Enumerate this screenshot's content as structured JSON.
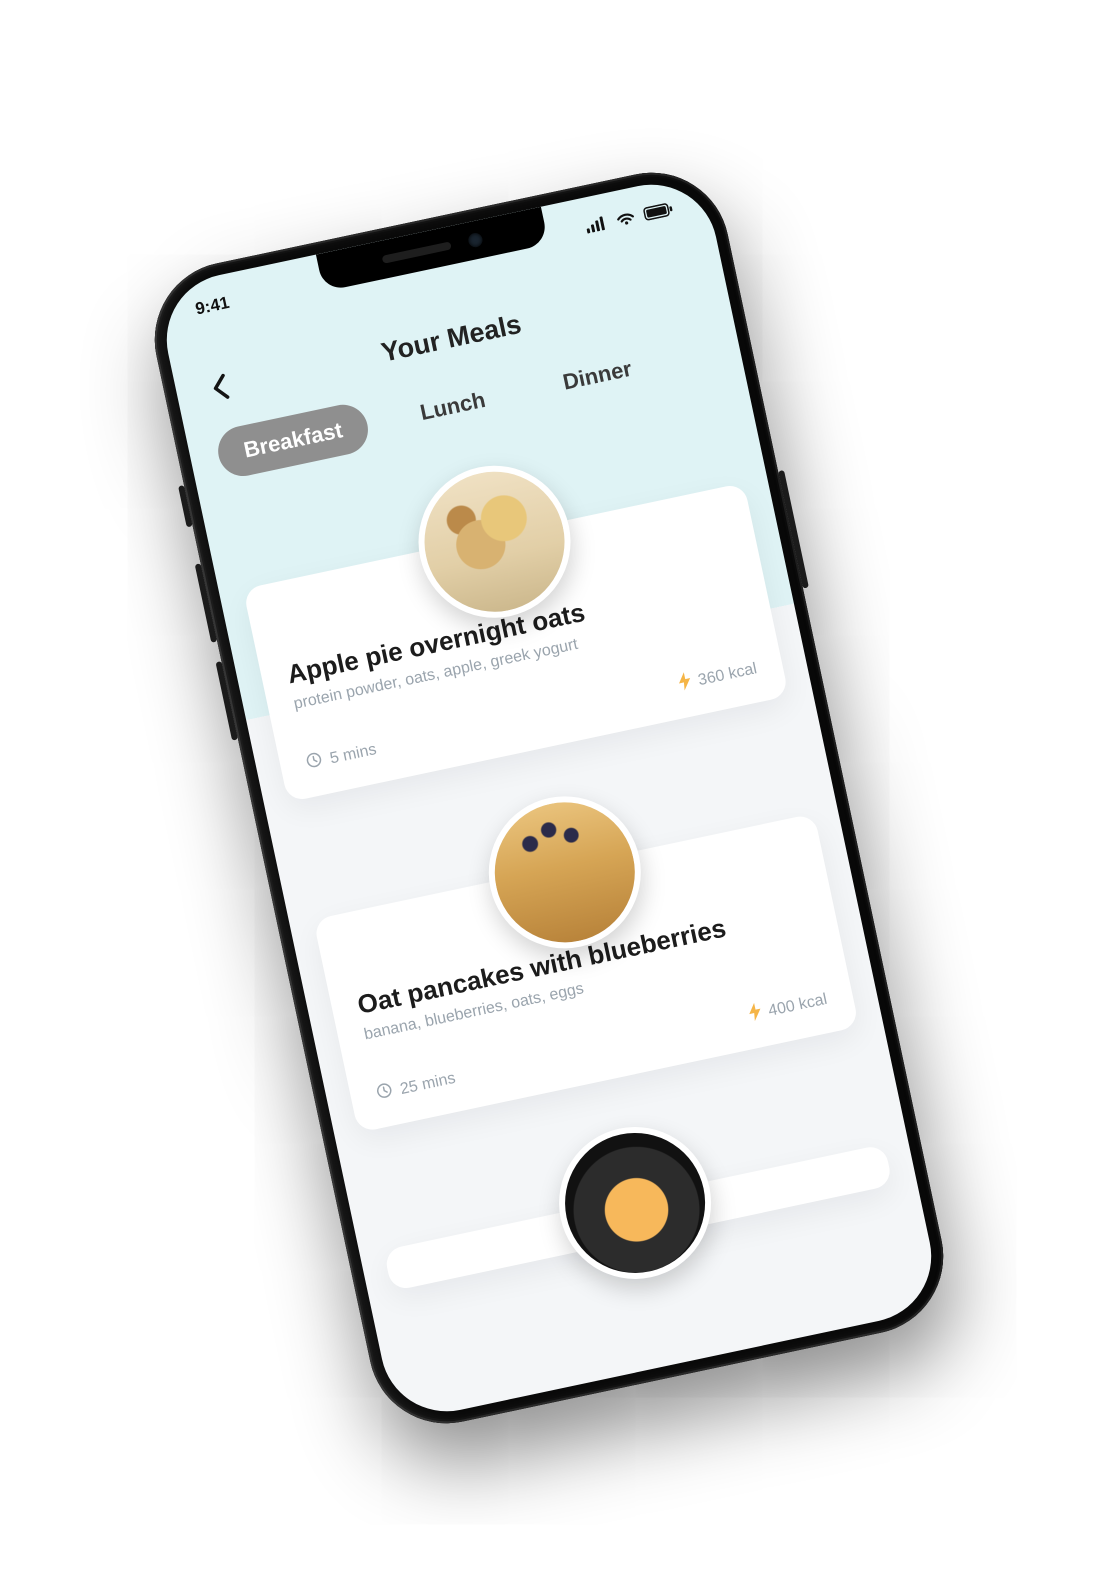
{
  "status": {
    "time": "9:41"
  },
  "header": {
    "title": "Your Meals"
  },
  "tabs": [
    {
      "label": "Breakfast",
      "active": true
    },
    {
      "label": "Lunch",
      "active": false
    },
    {
      "label": "Dinner",
      "active": false
    }
  ],
  "meals": [
    {
      "name": "Apple pie overnight oats",
      "ingredients": "protein powder, oats, apple, greek yogurt",
      "time": "5 mins",
      "kcal": "360 kcal"
    },
    {
      "name": "Oat pancakes with blueberries",
      "ingredients": "banana, blueberries, oats, eggs",
      "time": "25 mins",
      "kcal": "400 kcal"
    }
  ]
}
